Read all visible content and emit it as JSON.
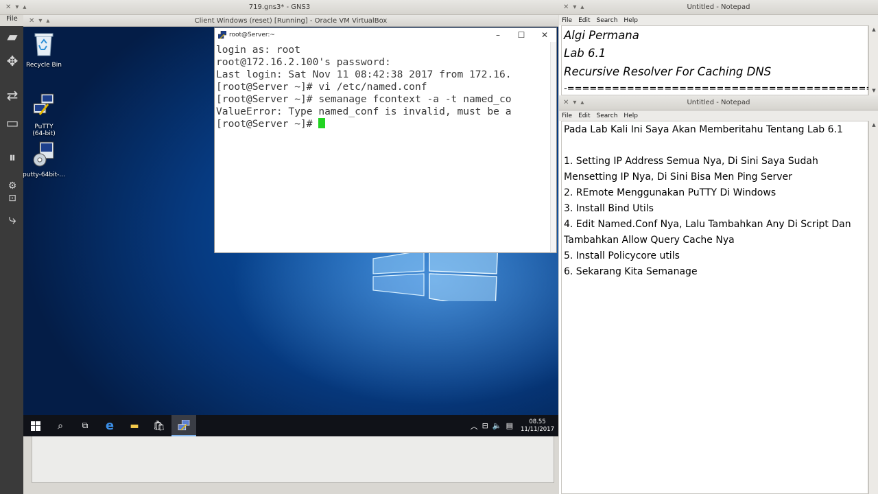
{
  "gns3": {
    "title": "719.gns3* - GNS3",
    "menu_file": "File"
  },
  "vbox": {
    "title": "Client Windows (reset) [Running] - Oracle VM VirtualBox"
  },
  "desktop": {
    "icons": [
      {
        "label": "Recycle Bin",
        "icon": "recycle-bin-icon"
      },
      {
        "label": "PuTTY\n(64-bit)",
        "icon": "putty-icon"
      },
      {
        "label": "putty-64bit-...",
        "icon": "installer-icon"
      }
    ]
  },
  "putty": {
    "title": "root@Server:~",
    "lines": [
      "login as: root",
      "root@172.16.2.100's password:",
      "Last login: Sat Nov 11 08:42:38 2017 from 172.16.",
      "[root@Server ~]# vi /etc/named.conf",
      "[root@Server ~]# semanage fcontext -a -t named_co",
      "ValueError: Type named_conf is invalid, must be a",
      "[root@Server ~]# "
    ]
  },
  "taskbar": {
    "time": "08.55",
    "date": "11/11/2017"
  },
  "notepad1": {
    "title": "Untitled - Notepad",
    "menu": [
      "File",
      "Edit",
      "Search",
      "Help"
    ],
    "lines": [
      "Algi Permana",
      "Lab 6.1",
      "Recursive Resolver For Caching DNS",
      "-=============================================-"
    ]
  },
  "notepad2": {
    "title": "Untitled - Notepad",
    "menu": [
      "File",
      "Edit",
      "Search",
      "Help"
    ],
    "lines": [
      "Pada Lab Kali Ini Saya Akan Memberitahu Tentang Lab 6.1",
      "",
      "1. Setting IP Address Semua Nya, Di Sini Saya Sudah",
      "Mensetting IP Nya, Di Sini Bisa Men Ping Server",
      "2. REmote Menggunakan PuTTY Di Windows",
      "3. Install Bind Utils",
      "4. Edit Named.Conf Nya, Lalu Tambahkan Any Di Script Dan",
      "Tambahkan Allow Query Cache Nya",
      "5. Install Policycore utils",
      "6. Sekarang Kita Semanage"
    ]
  }
}
